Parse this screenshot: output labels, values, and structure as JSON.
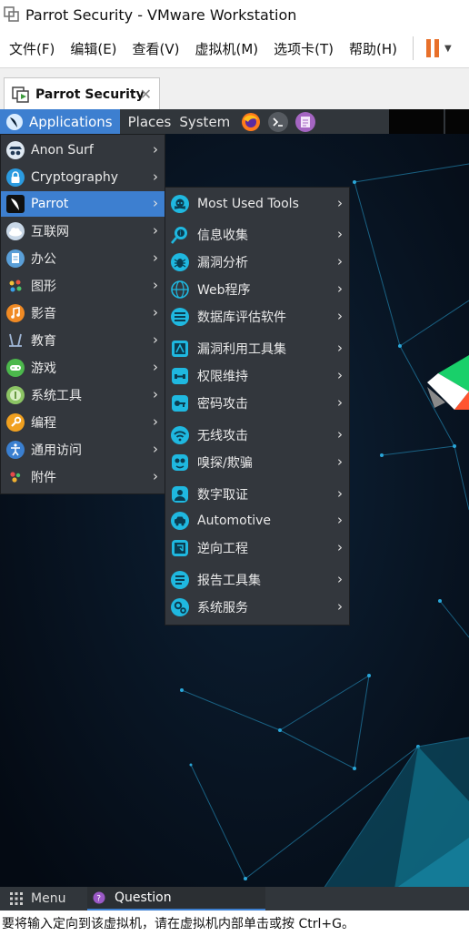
{
  "window": {
    "title": "Parrot Security - VMware Workstation"
  },
  "menubar": {
    "items": [
      "文件(F)",
      "编辑(E)",
      "查看(V)",
      "虚拟机(M)",
      "选项卡(T)",
      "帮助(H)"
    ]
  },
  "tab": {
    "label": "Parrot Security",
    "close": "✕"
  },
  "top_panel": {
    "applications": "Applications",
    "places": "Places",
    "system": "System",
    "launchers": [
      "firefox-icon",
      "terminal-icon",
      "text-editor-icon"
    ]
  },
  "main_menu": {
    "items": [
      {
        "label": "Anon Surf",
        "icon": "anonsurf-icon"
      },
      {
        "label": "Cryptography",
        "icon": "lock-icon"
      },
      {
        "label": "Parrot",
        "icon": "parrot-icon",
        "active": true
      },
      {
        "label": "互联网",
        "icon": "cloud-icon"
      },
      {
        "label": "办公",
        "icon": "document-icon"
      },
      {
        "label": "图形",
        "icon": "graphics-icon"
      },
      {
        "label": "影音",
        "icon": "music-icon"
      },
      {
        "label": "教育",
        "icon": "education-icon"
      },
      {
        "label": "游戏",
        "icon": "gamepad-icon"
      },
      {
        "label": "系统工具",
        "icon": "system-tools-icon"
      },
      {
        "label": "编程",
        "icon": "wrench-icon"
      },
      {
        "label": "通用访问",
        "icon": "accessibility-icon"
      },
      {
        "label": "附件",
        "icon": "accessories-icon"
      }
    ]
  },
  "sub_menu": {
    "items": [
      {
        "label": "Most Used Tools",
        "icon": "skull-icon"
      },
      {
        "label": "信息收集",
        "icon": "info-search-icon"
      },
      {
        "label": "漏洞分析",
        "icon": "bug-icon"
      },
      {
        "label": "Web程序",
        "icon": "web-icon"
      },
      {
        "label": "数据库评估软件",
        "icon": "database-icon"
      },
      {
        "label": "漏洞利用工具集",
        "icon": "exploit-icon"
      },
      {
        "label": "权限维持",
        "icon": "persistence-icon"
      },
      {
        "label": "密码攻击",
        "icon": "password-icon"
      },
      {
        "label": "无线攻击",
        "icon": "wireless-icon"
      },
      {
        "label": "嗅探/欺骗",
        "icon": "sniff-icon"
      },
      {
        "label": "数字取证",
        "icon": "forensics-icon"
      },
      {
        "label": "Automotive",
        "icon": "car-icon"
      },
      {
        "label": "逆向工程",
        "icon": "reverse-icon"
      },
      {
        "label": "报告工具集",
        "icon": "report-icon"
      },
      {
        "label": "系统服务",
        "icon": "services-icon"
      }
    ]
  },
  "taskbar": {
    "menu_label": "Menu",
    "task_label": "Question"
  },
  "status_bar": {
    "text": "要将输入定向到该虚拟机，请在虚拟机内部单击或按 Ctrl+G。"
  },
  "colors": {
    "accent": "#3d7fd0",
    "panel": "#31363b",
    "menu_bg": "#33373d",
    "submenu_icon": "#1fb8e0",
    "pause": "#e8702a"
  }
}
